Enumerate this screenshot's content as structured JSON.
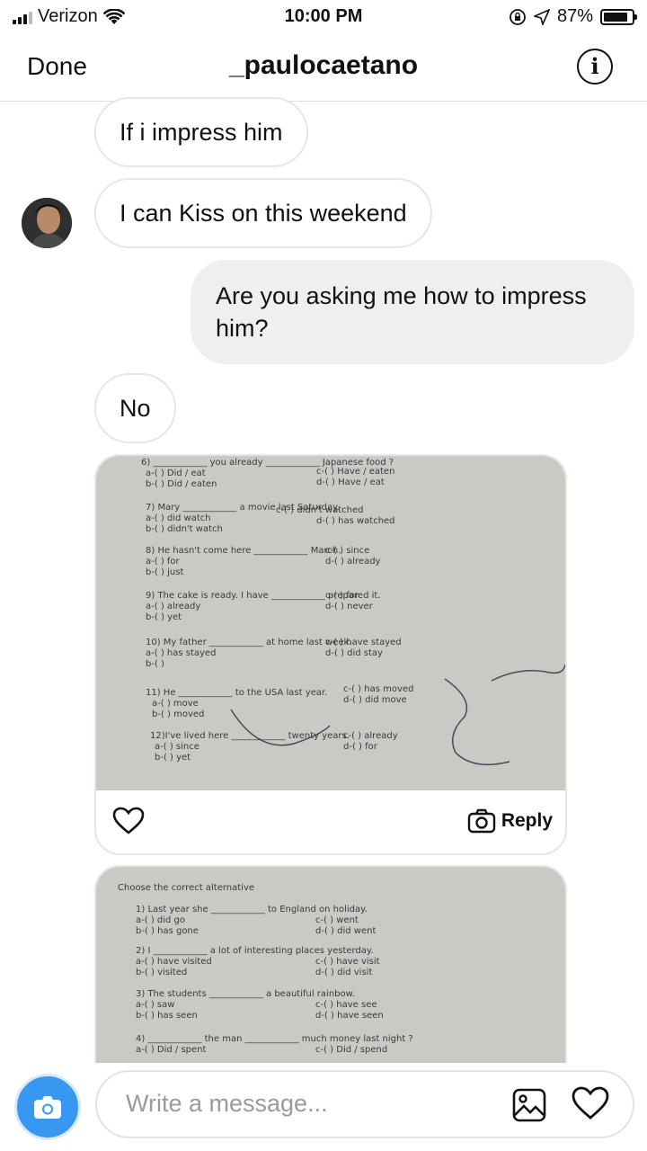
{
  "status": {
    "carrier": "Verizon",
    "time": "10:00 PM",
    "battery": "87%",
    "battery_level": 0.87
  },
  "header": {
    "done": "Done",
    "title": "_paulocaetano",
    "info_icon": "i"
  },
  "messages": {
    "m1": "If i impress him",
    "m2": "I can Kiss on this weekend",
    "m3": "Are you asking me how to impress him?",
    "m4": "No"
  },
  "photo1": {
    "reply": "Reply",
    "lines": [
      "6) ____________ you already ____________ Japanese food ?",
      "a-(  ) Did / eat",
      "b-(  ) Did / eaten",
      "c-(  ) Have / eaten",
      "d-(  ) Have / eat",
      "7) Mary ____________ a movie last Saturday.",
      "a-(  ) did watch",
      "b-(  ) didn't watch",
      "c-(  ) didn't watched",
      "d-(  ) has watched",
      "8) He hasn't come here ____________ March.",
      "a-(  ) for",
      "b-(  ) just",
      "c-(  ) since",
      "d-(  ) already",
      "9) The cake is ready. I have ____________ prepared it.",
      "a-(  ) already",
      "b-(  ) yet",
      "c-(  ) for",
      "d-(  ) never",
      "10) My father ____________ at home last week.",
      "a-(  ) has stayed",
      "b-(  )",
      "c-(  ) have stayed",
      "d-(  ) did stay",
      "11) He ____________ to the USA last year.",
      "a-(  ) move",
      "b-(  ) moved",
      "c-(  ) has moved",
      "d-(  ) did move",
      "12)I've lived here ____________ twenty years.",
      "a-(  ) since",
      "b-(  ) yet",
      "c-(  ) already",
      "d-(  ) for"
    ]
  },
  "photo2": {
    "lines": [
      "Choose the correct alternative",
      "1) Last year she ____________ to England on holiday.",
      "a-(  ) did go",
      "b-(  ) has gone",
      "c-(  ) went",
      "d-(  ) did went",
      "2) I ____________ a lot of interesting places yesterday.",
      "a-(  ) have visited",
      "b-(  ) visited",
      "c-(  ) have visit",
      "d-(  ) did visit",
      "3) The students ____________ a beautiful rainbow.",
      "a-(  ) saw",
      "b-(  ) has seen",
      "c-(  ) have see",
      "d-(  ) have seen",
      "4) ____________ the man ____________ much money last night ?",
      "a-(  ) Did / spent",
      "c-(  ) Did / spend"
    ]
  },
  "composer": {
    "placeholder": "Write a message..."
  },
  "colors": {
    "accent": "#3897f0",
    "outgoing_bubble": "#efefef",
    "bubble_border": "#e6e6e6"
  }
}
